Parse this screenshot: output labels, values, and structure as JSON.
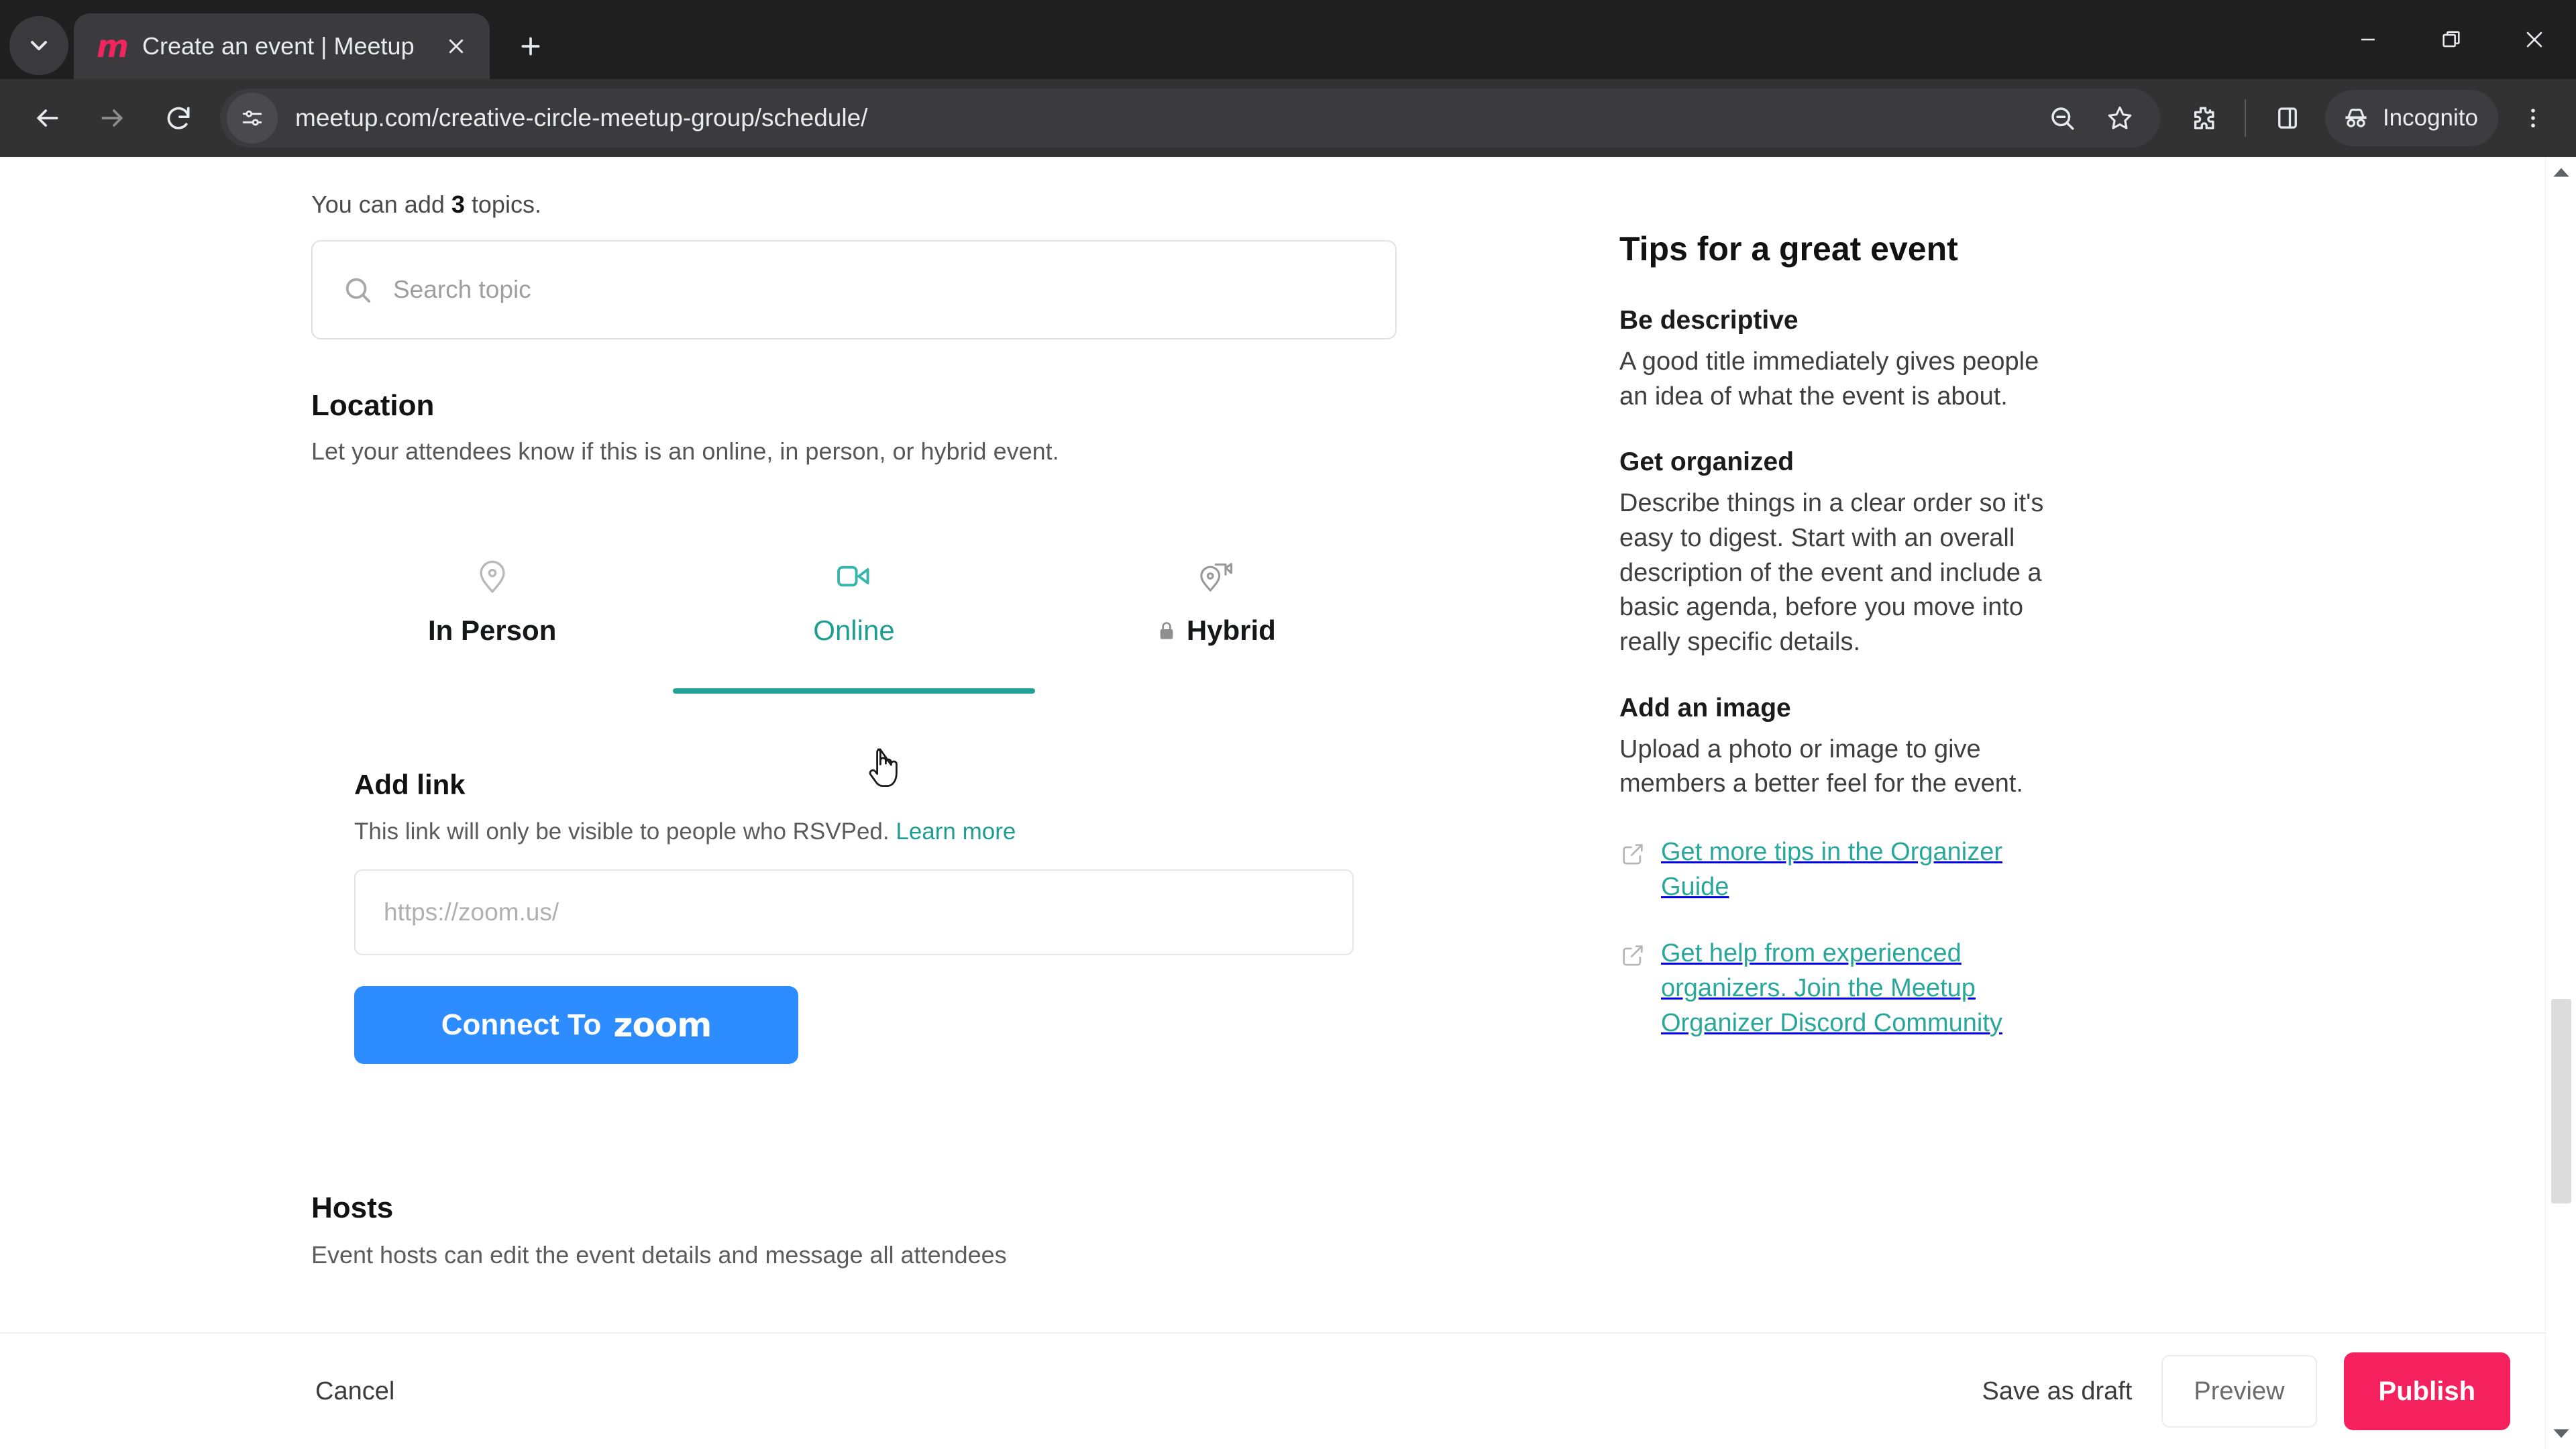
{
  "browser": {
    "tab": {
      "title": "Create an event | Meetup",
      "favicon_name": "meetup-logo-icon",
      "favicon_glyph": "m",
      "close_label": "x"
    },
    "new_tab_label": "+",
    "url": "meetup.com/creative-circle-meetup-group/schedule/",
    "profile_label": "Incognito",
    "window_controls": {
      "minimize": "minimize-icon",
      "maximize": "restore-icon",
      "close": "close-icon"
    },
    "toolbar_icons": [
      "zoom-out-icon",
      "bookmark-star-icon",
      "extensions-icon",
      "side-panel-icon",
      "incognito-icon",
      "kebab-menu-icon"
    ]
  },
  "form": {
    "topics_note_prefix": "You can add ",
    "topics_count": "3",
    "topics_note_suffix": " topics.",
    "topic_search_placeholder": "Search topic",
    "location": {
      "title": "Location",
      "subtitle": "Let your attendees know if this is an online, in person, or hybrid event.",
      "tabs": [
        {
          "label": "In Person",
          "icon": "map-pin-icon",
          "active": false,
          "locked": false
        },
        {
          "label": "Online",
          "icon": "video-camera-icon",
          "active": true,
          "locked": false
        },
        {
          "label": "Hybrid",
          "icon": "map-pin-camera-icon",
          "active": false,
          "locked": true
        }
      ]
    },
    "add_link": {
      "title": "Add link",
      "description": "This link will only be visible to people who RSVPed.",
      "learn_more": "Learn more",
      "input_placeholder": "https://zoom.us/",
      "zoom_button_text": "Connect To",
      "zoom_button_brand": "zoom"
    },
    "hosts": {
      "title": "Hosts",
      "description": "Event hosts can edit the event details and message all attendees"
    }
  },
  "tips": {
    "title": "Tips for a great event",
    "items": [
      {
        "heading": "Be descriptive",
        "body": "A good title immediately gives people an idea of what the event is about."
      },
      {
        "heading": "Get organized",
        "body": "Describe things in a clear order so it's easy to digest. Start with an overall description of the event and include a basic agenda, before you move into really specific details."
      },
      {
        "heading": "Add an image",
        "body": "Upload a photo or image to give members a better feel for the event."
      }
    ],
    "links": [
      {
        "text": "Get more tips in the Organizer Guide",
        "icon": "external-link-icon"
      },
      {
        "text": "Get help from experienced organizers. Join the Meetup Organizer Discord Community",
        "icon": "external-link-icon"
      }
    ]
  },
  "footer": {
    "cancel": "Cancel",
    "save_draft": "Save as draft",
    "preview": "Preview",
    "publish": "Publish"
  },
  "colors": {
    "accent_teal": "#23a396",
    "brand_pink": "#f4215e",
    "zoom_blue": "#2d8cff",
    "chrome_dark": "#1f1f1f"
  }
}
